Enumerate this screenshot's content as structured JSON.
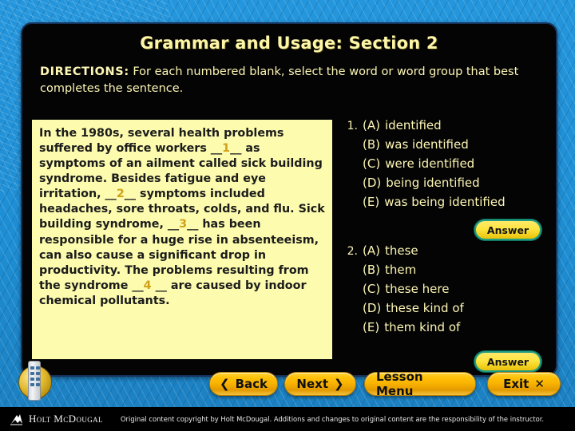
{
  "slide": {
    "title": "Grammar and Usage: Section 2",
    "directions_lead": "DIRECTIONS:",
    "directions_text": " For each numbered blank, select the word or word group that best completes the sentence."
  },
  "passage": {
    "p1": "In the 1980s, several health problems suffered by office workers __",
    "blank1": "1",
    "p2": "__ as symptoms of an ailment called sick building syndrome. Besides fatigue and eye irritation, __",
    "blank2": "2",
    "p3": "__ symptoms included headaches, sore throats, colds, and flu. Sick building syndrome, __",
    "blank3": "3",
    "p4": "__ has been responsible for a huge rise in absenteeism, can also cause a significant drop in productivity. The problems resulting from the syndrome __",
    "blank4": "4",
    "p5": " __ are caused by indoor chemical pollutants."
  },
  "questions": [
    {
      "number": "1.",
      "answer_label": "Answer",
      "choices": [
        {
          "label": "(A)",
          "text": "identified"
        },
        {
          "label": "(B)",
          "text": "was identified"
        },
        {
          "label": "(C)",
          "text": "were identified"
        },
        {
          "label": "(D)",
          "text": "being identified"
        },
        {
          "label": "(E)",
          "text": "was being identified"
        }
      ]
    },
    {
      "number": "2.",
      "answer_label": "Answer",
      "choices": [
        {
          "label": "(A)",
          "text": "these"
        },
        {
          "label": "(B)",
          "text": "them"
        },
        {
          "label": "(C)",
          "text": "these here"
        },
        {
          "label": "(D)",
          "text": "these kind of"
        },
        {
          "label": "(E)",
          "text": "them kind of"
        }
      ]
    }
  ],
  "nav": {
    "back": "Back",
    "back_glyph": "❮",
    "next": "Next",
    "next_glyph": "❯",
    "lesson_menu": "Lesson Menu",
    "exit": "Exit",
    "exit_glyph": "✕"
  },
  "footer": {
    "brand": "Holt McDougal",
    "copyright": "Original content copyright by Holt McDougal.  Additions and changes to original content are the responsibility of the instructor."
  },
  "colors": {
    "background_blue": "#1e8ed4",
    "panel_black": "#040404",
    "text_yellow": "#fdf6b4",
    "passage_bg": "#fcfbae",
    "blank_number": "#d1a016",
    "button_gold": "#f8b200",
    "answer_border": "#1f9e84"
  }
}
